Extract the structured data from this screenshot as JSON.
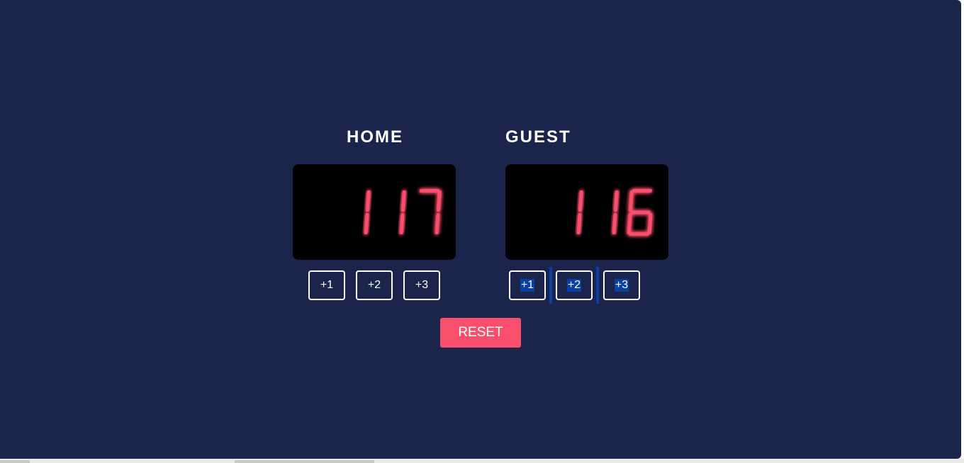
{
  "home": {
    "title": "HOME",
    "score": "117",
    "buttons": [
      "+1",
      "+2",
      "+3"
    ]
  },
  "guest": {
    "title": "GUEST",
    "score": "116",
    "buttons": [
      "+1",
      "+2",
      "+3"
    ]
  },
  "reset_label": "RESET",
  "colors": {
    "background": "#1b244a",
    "digit": "#f94f6d",
    "score_panel": "#000000",
    "selection": "#0a3fa3"
  }
}
